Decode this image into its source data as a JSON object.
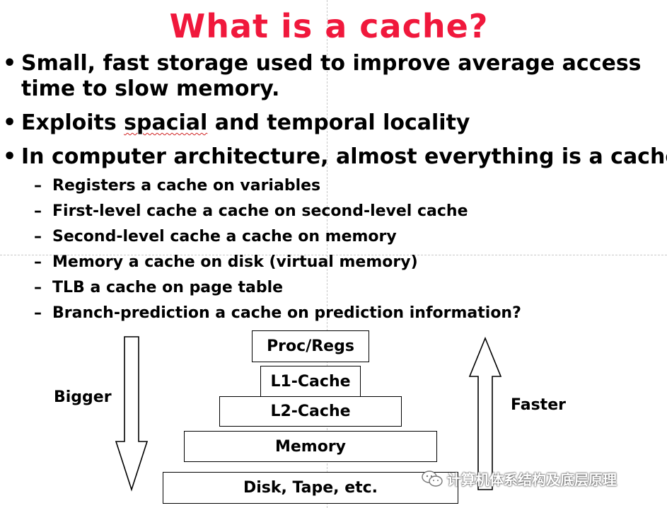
{
  "slide": {
    "title": "What is a cache?",
    "bullets": [
      {
        "line1": "Small, fast storage used to improve average access",
        "line2": "time to slow memory."
      },
      {
        "before": "Exploits ",
        "underlined": "spacial",
        "after": " and temporal locality"
      },
      {
        "text": "In computer architecture, almost everything is a cache!"
      }
    ],
    "sub_bullets": [
      "Registers a cache on variables",
      "First-level cache a cache on second-level cache",
      "Second-level cache a cache on memory",
      "Memory a cache on disk (virtual memory)",
      "TLB a cache on page table",
      "Branch-prediction a cache on prediction information?"
    ],
    "bullet_symbol": "•",
    "dash_symbol": "–"
  },
  "hierarchy": {
    "levels": [
      "Proc/Regs",
      "L1-Cache",
      "L2-Cache",
      "Memory",
      "Disk, Tape, etc."
    ],
    "left_label": "Bigger",
    "right_label": "Faster",
    "left_arrow_direction": "down",
    "right_arrow_direction": "up"
  },
  "watermark": {
    "text": "计算机体系结构及底层原理",
    "icon": "wechat-icon"
  },
  "colors": {
    "title": "#f0183c",
    "text": "#000000",
    "spellcheck_underline": "#d02020"
  }
}
